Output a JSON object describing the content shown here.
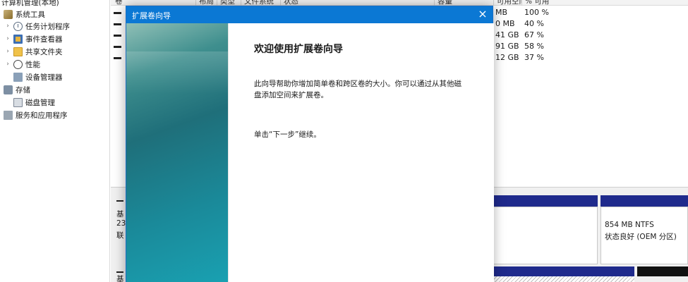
{
  "tree": {
    "items": [
      {
        "label": "计算机管理(本地)",
        "chevron": "",
        "icon": "computer-icon"
      },
      {
        "label": "系统工具",
        "chevron": "",
        "icon": "tools-icon"
      },
      {
        "label": "任务计划程序",
        "chevron": "›",
        "icon": "clock-icon"
      },
      {
        "label": "事件查看器",
        "chevron": "›",
        "icon": "event-viewer-icon"
      },
      {
        "label": "共享文件夹",
        "chevron": "›",
        "icon": "shared-folder-icon"
      },
      {
        "label": "性能",
        "chevron": "›",
        "icon": "performance-icon"
      },
      {
        "label": "设备管理器",
        "chevron": "",
        "icon": "device-manager-icon"
      },
      {
        "label": "存储",
        "chevron": "",
        "icon": "storage-icon"
      },
      {
        "label": "磁盘管理",
        "chevron": "",
        "icon": "disk-icon"
      },
      {
        "label": "服务和应用程序",
        "chevron": "",
        "icon": "services-icon"
      }
    ]
  },
  "volumes": {
    "headers": [
      "卷",
      "布局",
      "类型",
      "文件系统",
      "状态",
      "容量",
      "可用空间",
      "% 可用"
    ],
    "rows": [
      {
        "free": "MB",
        "pct": "100 %"
      },
      {
        "free": "0 MB",
        "pct": "40 %"
      },
      {
        "free": "41 GB",
        "pct": "67 %"
      },
      {
        "free": "91 GB",
        "pct": "58 %"
      },
      {
        "free": "12 GB",
        "pct": "37 %"
      }
    ]
  },
  "disks": {
    "disk0": {
      "line1": "基",
      "line2": "23",
      "line3": "联"
    },
    "disk1": {
      "line1": "基"
    },
    "partition": {
      "size": "854 MB NTFS",
      "status": "状态良好 (OEM 分区)"
    }
  },
  "wizard": {
    "title": "扩展卷向导",
    "close": "×",
    "heading": "欢迎使用扩展卷向导",
    "description": "此向导帮助你增加简单卷和跨区卷的大小。你可以通过从其他磁盘添加空间来扩展卷。",
    "continue_text": "单击“下一步”继续。"
  },
  "colors": {
    "title_bar": "#0b78d4",
    "partition_bar": "#1f2a8c"
  }
}
